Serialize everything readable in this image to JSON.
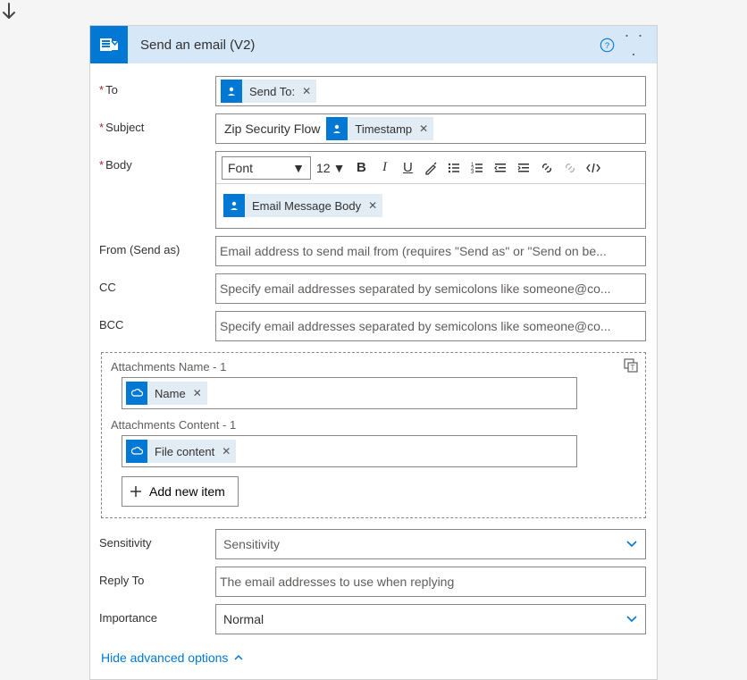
{
  "header": {
    "title": "Send an email (V2)"
  },
  "fields": {
    "to_label": "To",
    "subject_label": "Subject",
    "body_label": "Body",
    "from_label": "From (Send as)",
    "cc_label": "CC",
    "bcc_label": "BCC",
    "sensitivity_label": "Sensitivity",
    "replyto_label": "Reply To",
    "importance_label": "Importance"
  },
  "tokens": {
    "send_to": "Send To:",
    "timestamp": "Timestamp",
    "email_body": "Email Message Body",
    "name": "Name",
    "file_content": "File content"
  },
  "subject_text": "Zip Security Flow",
  "placeholders": {
    "from": "Email address to send mail from (requires \"Send as\" or \"Send on be...",
    "cc": "Specify email addresses separated by semicolons like someone@co...",
    "bcc": "Specify email addresses separated by semicolons like someone@co...",
    "sensitivity": "Sensitivity",
    "replyto": "The email addresses to use when replying"
  },
  "attachments": {
    "name_label": "Attachments Name - 1",
    "content_label": "Attachments Content - 1",
    "add_item": "Add new item"
  },
  "toolbar": {
    "font_label": "Font",
    "size": "12"
  },
  "importance_value": "Normal",
  "advanced_toggle": "Hide advanced options"
}
